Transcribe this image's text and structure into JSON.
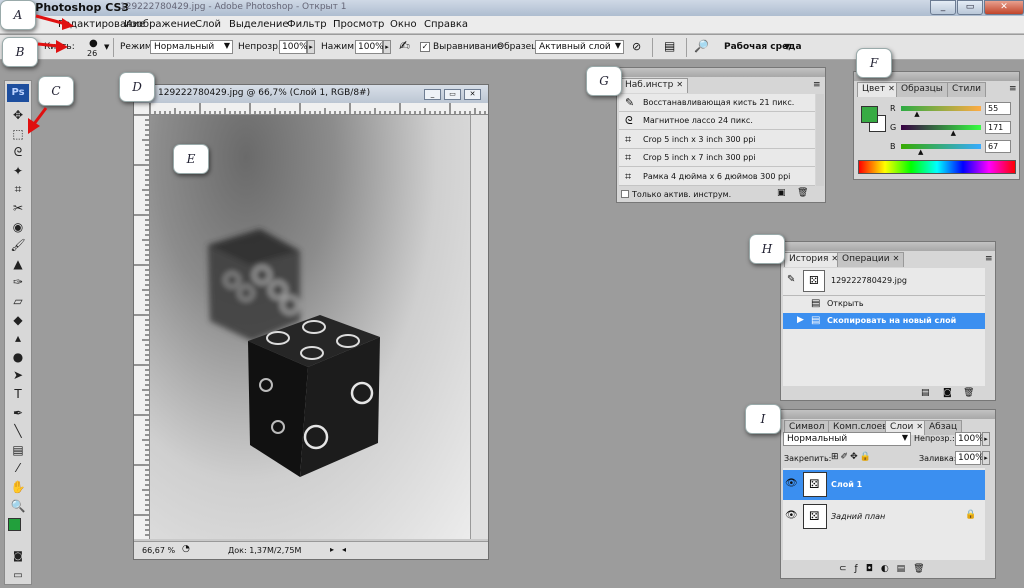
{
  "window": {
    "title": "e Photoshop CS3",
    "title_faded": "129222780429.jpg - Adobe Photoshop - Открыт 1",
    "min": "_",
    "restore": "▭",
    "close": "✕"
  },
  "menu": [
    "Редактирование",
    "Изображение",
    "Слой",
    "Выделение",
    "Фильтр",
    "Просмотр",
    "Окно",
    "Справка"
  ],
  "options": {
    "brush_label": "Кисть:",
    "brush_size": "26",
    "mode_label": "Режим:",
    "mode_value": "Нормальный",
    "opacity_label": "Непрозр.:",
    "opacity_value": "100%",
    "pressure_label": "Нажим:",
    "pressure_value": "100%",
    "align_label": "Выравнивание",
    "sample_label": "Образец:",
    "sample_value": "Активный слой",
    "workspace": "Рабочая среда"
  },
  "toolbox": {
    "logo": "Ps",
    "tools": [
      "move-tool-icon",
      "marquee-tool-icon",
      "lasso-tool-icon",
      "magic-wand-tool-icon",
      "crop-tool-icon",
      "slice-tool-icon",
      "healing-tool-icon",
      "brush-tool-icon",
      "stamp-tool-icon",
      "history-brush-tool-icon",
      "eraser-tool-icon",
      "bucket-tool-icon",
      "blur-tool-icon",
      "dodge-tool-icon",
      "path-select-tool-icon",
      "type-tool-icon",
      "pen-tool-icon",
      "line-tool-icon",
      "notes-tool-icon",
      "eyedropper-tool-icon",
      "hand-tool-icon",
      "zoom-tool-icon"
    ],
    "tool_glyphs": [
      "✥",
      "⬚",
      "ᘓ",
      "✦",
      "⌗",
      "✂",
      "◉",
      "🖌",
      "▲",
      "✑",
      "▱",
      "◆",
      "▴",
      "●",
      "➤",
      "T",
      "✒",
      "╲",
      "▤",
      "⁄",
      "✋",
      "🔍"
    ],
    "fg_color": "#22a03c",
    "bg_color": "#ffffff"
  },
  "document": {
    "title": "129222780429.jpg @ 66,7% (Слой 1, RGB/8#)",
    "zoom": "66,67 %",
    "doc_info": "Док: 1,37M/2,75M"
  },
  "tool_presets": {
    "tab": "Наб.инстр",
    "items": [
      "Восстанавливающая кисть 21 пикс.",
      "Магнитное лассо 24 пикс.",
      "Crop 5 inch x 3 inch 300 ppi",
      "Crop 5 inch x 7 inch 300 ppi",
      "Рамка 4 дюйма x 6 дюймов 300 ppi"
    ],
    "footer": "Только актив. инструм."
  },
  "color_panel": {
    "tabs": [
      "Цвет",
      "Образцы",
      "Стили"
    ],
    "channels": [
      {
        "name": "R",
        "value": "55",
        "fill": 0.216
      },
      {
        "name": "G",
        "value": "171",
        "fill": 0.671
      },
      {
        "name": "B",
        "value": "67",
        "fill": 0.263
      }
    ],
    "swatch": "#37ab43"
  },
  "history": {
    "tabs": [
      "История",
      "Операции"
    ],
    "snapshot": "129222780429.jpg",
    "items": [
      "Открыть",
      "Скопировать на новый слой"
    ]
  },
  "layers": {
    "tabs": [
      "Символ",
      "Комп.слоев",
      "Слои",
      "Абзац"
    ],
    "blend": "Нормальный",
    "opacity_label": "Непрозр.:",
    "opacity": "100%",
    "lock_label": "Закрепить:",
    "fill_label": "Заливка:",
    "fill": "100%",
    "items": [
      "Слой 1",
      "Задний план"
    ]
  },
  "badges": [
    "A",
    "B",
    "C",
    "D",
    "E",
    "F",
    "G",
    "H",
    "I"
  ],
  "colors": {
    "selection": "#3b8ff0",
    "accent": "#1d4e9e"
  }
}
